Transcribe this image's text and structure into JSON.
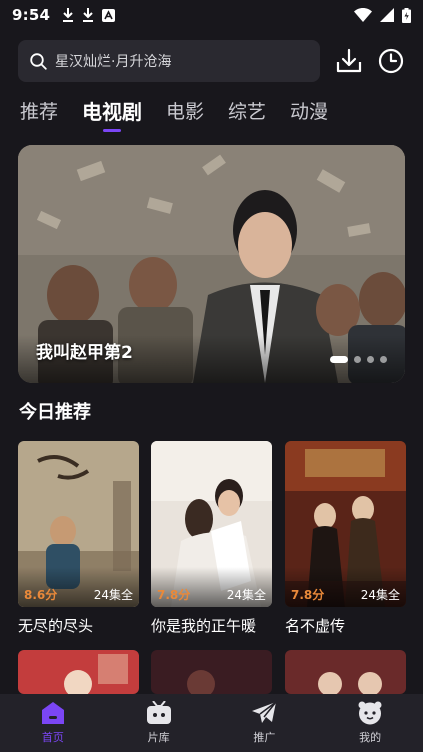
{
  "status_bar": {
    "time": "9:54",
    "icons_left": [
      "download-notification-icon",
      "download-notification-icon",
      "app-notification-icon"
    ],
    "icons_right": [
      "wifi-icon",
      "signal-icon",
      "battery-icon"
    ]
  },
  "search": {
    "placeholder": "星汉灿烂·月升沧海"
  },
  "top_actions": [
    "download-icon",
    "history-icon"
  ],
  "tabs": [
    {
      "label": "推荐",
      "active": false
    },
    {
      "label": "电视剧",
      "active": true
    },
    {
      "label": "电影",
      "active": false
    },
    {
      "label": "综艺",
      "active": false
    },
    {
      "label": "动漫",
      "active": false
    }
  ],
  "banner": {
    "title": "我叫赵甲第2",
    "dot_count": 4,
    "active_dot": 0
  },
  "section": {
    "title": "今日推荐"
  },
  "cards": [
    {
      "title": "无尽的尽头",
      "rating": "8.6分",
      "episodes": "24集全"
    },
    {
      "title": "你是我的正午暖",
      "rating": "7.8分",
      "episodes": "24集全"
    },
    {
      "title": "名不虚传",
      "rating": "7.8分",
      "episodes": "24集全"
    }
  ],
  "nav": [
    {
      "label": "首页",
      "icon": "home-icon",
      "active": true
    },
    {
      "label": "片库",
      "icon": "library-icon",
      "active": false
    },
    {
      "label": "推广",
      "icon": "share-plane-icon",
      "active": false
    },
    {
      "label": "我的",
      "icon": "profile-face-icon",
      "active": false
    }
  ],
  "colors": {
    "accent": "#7b46f5",
    "background": "#18171c",
    "rating": "#e9893a",
    "nav_background": "#232229"
  }
}
